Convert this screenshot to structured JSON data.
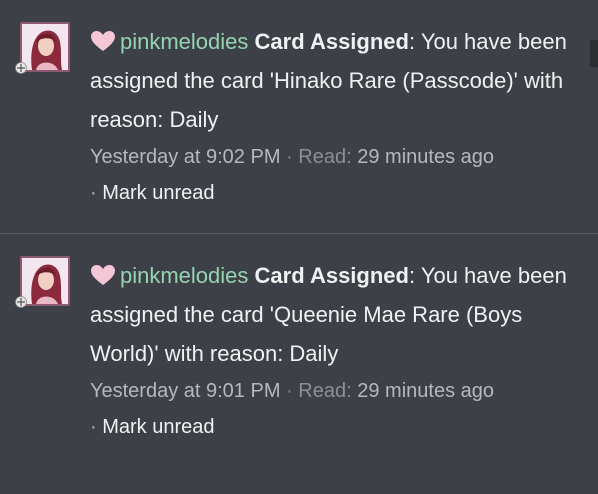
{
  "notifications": [
    {
      "username": "pinkmelodies",
      "title": "Card Assigned",
      "separator": ":",
      "message": " You have been assigned the card 'Hinako Rare (Passcode)' with reason: Daily",
      "time": "Yesterday at 9:02 PM",
      "meta_sep": "·",
      "read_label": "Read:",
      "read_time": "29 minutes ago",
      "action_sep": "·",
      "action_label": "Mark unread"
    },
    {
      "username": "pinkmelodies",
      "title": "Card Assigned",
      "separator": ":",
      "message": " You have been assigned the card 'Queenie Mae Rare (Boys World)' with reason: Daily",
      "time": "Yesterday at 9:01 PM",
      "meta_sep": "·",
      "read_label": "Read:",
      "read_time": "29 minutes ago",
      "action_sep": "·",
      "action_label": "Mark unread"
    }
  ],
  "colors": {
    "background": "#3d4046",
    "username": "#96d3b3",
    "heart": "#f5c6d6",
    "text": "#f0f1f2",
    "meta": "#b5b8bd"
  },
  "icons": {
    "heart": "heart-icon",
    "avatar": "avatar",
    "badge": "move-badge-icon"
  }
}
